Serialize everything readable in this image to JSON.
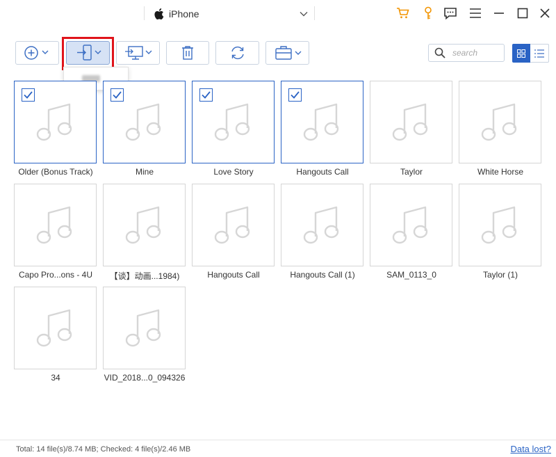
{
  "titlebar": {
    "device_name": "iPhone",
    "icons": [
      "apple-icon",
      "chevron-down-icon",
      "cart-icon",
      "key-icon",
      "feedback-icon",
      "menu-icon",
      "minimize-icon",
      "maximize-icon",
      "close-icon"
    ]
  },
  "toolbar": {
    "buttons": [
      "add-icon",
      "export-to-device-icon",
      "export-to-pc-icon",
      "delete-icon",
      "refresh-icon",
      "toolbox-icon"
    ],
    "search_placeholder": "search",
    "view_modes": [
      "grid",
      "list"
    ],
    "accent_color": "#2a63c5",
    "highlight_color": "#e0141b"
  },
  "files": [
    {
      "name": "Older (Bonus Track)",
      "checked": true
    },
    {
      "name": "Mine",
      "checked": true
    },
    {
      "name": "Love Story",
      "checked": true
    },
    {
      "name": "Hangouts Call",
      "checked": true
    },
    {
      "name": "Taylor",
      "checked": false
    },
    {
      "name": "White Horse",
      "checked": false
    },
    {
      "name": "Capo Pro...ons - 4U",
      "checked": false
    },
    {
      "name": "【谈】动画...1984)",
      "checked": false
    },
    {
      "name": "Hangouts Call",
      "checked": false
    },
    {
      "name": "Hangouts Call (1)",
      "checked": false
    },
    {
      "name": "SAM_0113_0",
      "checked": false
    },
    {
      "name": "Taylor (1)",
      "checked": false
    },
    {
      "name": "34",
      "checked": false
    },
    {
      "name": "VID_2018...0_094326",
      "checked": false
    }
  ],
  "status": {
    "summary": "Total: 14 file(s)/8.74 MB; Checked: 4 file(s)/2.46 MB",
    "data_lost_link": "Data lost?"
  }
}
